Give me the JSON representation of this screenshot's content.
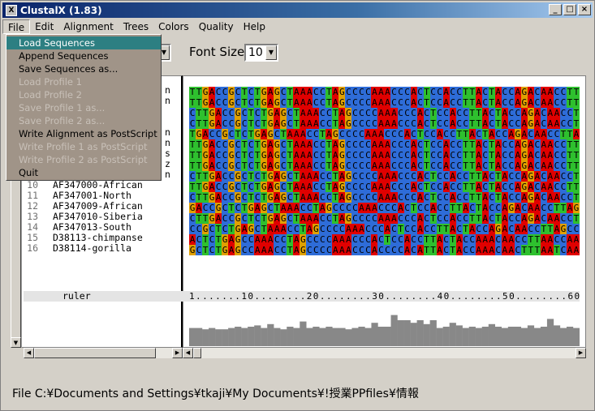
{
  "window": {
    "title": "ClustalX (1.83)",
    "app_icon": "X",
    "minimize": "_",
    "maximize": "□",
    "close": "×"
  },
  "menubar": [
    "File",
    "Edit",
    "Alignment",
    "Trees",
    "Colors",
    "Quality",
    "Help"
  ],
  "toolbar": {
    "font_size_label": "Font Size:",
    "font_size_value": "10"
  },
  "file_menu": [
    {
      "label": "Load Sequences",
      "state": "selected"
    },
    {
      "label": "Append Sequences",
      "state": "enabled"
    },
    {
      "label": "Save Sequences as...",
      "state": "enabled"
    },
    {
      "label": "Load Profile 1",
      "state": "disabled"
    },
    {
      "label": "Load Profile 2",
      "state": "disabled"
    },
    {
      "label": "Save Profile 1 as...",
      "state": "disabled"
    },
    {
      "label": "Save Profile 2 as...",
      "state": "disabled"
    },
    {
      "label": "Write Alignment as PostScript",
      "state": "enabled"
    },
    {
      "label": "Write Profile 1 as PostScript",
      "state": "disabled"
    },
    {
      "label": "Write Profile 2 as PostScript",
      "state": "disabled"
    },
    {
      "label": "Quit",
      "state": "enabled"
    }
  ],
  "sequences": [
    {
      "num": "",
      "name": "n",
      "seq": "TTGACCGCTCTGAGCTAAACCTAGCCCCAAACCCACTCCACCTTACTACCAGACAACCTT"
    },
    {
      "num": "",
      "name": "n",
      "seq": "TTGACCGCTCTGAGCTAAACCTAGCCCCAAACCCACTCCACCTTACTACCAGACAACCTT"
    },
    {
      "num": "",
      "name": "",
      "seq": "CTTGACCGCTCTGAGCTAAACCTAGCCCCAAACCCACTCCACCTTACTACCAGACAACCT"
    },
    {
      "num": "",
      "name": "",
      "seq": "CTTGACCGCTCTGAGCTAAACCTAGCCCCAAACCCACTCCACCTTACTACCAGACAACCT"
    },
    {
      "num": "",
      "name": "n",
      "seq": "TGACCGCTCTGAGCTAAACCTAGCCCCAAACCCACTCCACCTTACTACCAGACAACCTTA"
    },
    {
      "num": "",
      "name": "n",
      "seq": "TTGACCGCTCTGAGCTAAACCTAGCCCCAAACCCACTCCACCTTACTACCAGACAACCTT"
    },
    {
      "num": "",
      "name": "s",
      "seq": "TTGACCGCTCTGAGCTAAACCTAGCCCCAAACCCACTCCACCTTACTACCAGACAACCTT"
    },
    {
      "num": "",
      "name": "z",
      "seq": "TTGACCGCTCTGAGCTAAACCTAGCCCCAAACCCACTCCACCTTACTACCAGACAACCTT"
    },
    {
      "num": "",
      "name": "n",
      "seq": "CTTGACCGCTCTGAGCTAAACCTAGCCCCAAACCCACTCCACCTTACTACCAGACAACCT"
    },
    {
      "num": "10",
      "name": "AF347000-African",
      "seq": "TTGACCGCTCTGAGCTAAACCTAGCCCCAAACCCACTCCACCTTACTACCAGACAACCTT"
    },
    {
      "num": "11",
      "name": "AF347001-North",
      "seq": "CTTGACCGCTCTGAGCTAAACCTAGCCCCAAACCCACTCCACCTTACTACCAGACAACCT"
    },
    {
      "num": "12",
      "name": "AF347009-African",
      "seq": "GACCGCTCTGAGCTAAACCTAGCCCCAAACCCACTCCACCTTACTACCAGACAACCTTAG"
    },
    {
      "num": "13",
      "name": "AF347010-Siberia",
      "seq": "CTTGACCGCTCTGAGCTAAACCTAGCCCCAAACCCACTCCACCTTACTACCAGACAACCT"
    },
    {
      "num": "14",
      "name": "AF347013-South",
      "seq": "CCGCTCTGAGCTAAACCTAGCCCCAAACCCACTCCACCTTACTACCAGACAACCTTAGCC"
    },
    {
      "num": "15",
      "name": "D38113-chimpanse",
      "seq": "ACTCTGAGCCAAACCTAGCCCCAAACCCACTCCACCTTACTACCAAACAACCTTAACCAA"
    },
    {
      "num": "16",
      "name": "D38114-gorilla",
      "seq": "GCTCTGAGCCAAACCTAGCCCCAAACCCACCCCACATTACTACCAAACAACTTTAATCAA"
    }
  ],
  "ruler": {
    "label": "ruler",
    "text": "1.......10........20........30........40........50........60"
  },
  "quality_histogram": [
    14,
    14,
    13,
    14,
    13,
    13,
    14,
    15,
    14,
    15,
    16,
    14,
    17,
    14,
    13,
    15,
    14,
    19,
    14,
    15,
    14,
    15,
    14,
    14,
    13,
    14,
    15,
    14,
    18,
    15,
    15,
    24,
    20,
    20,
    18,
    20,
    17,
    20,
    14,
    15,
    18,
    16,
    14,
    15,
    14,
    15,
    17,
    15,
    14,
    15,
    15,
    14,
    16,
    14,
    15,
    21,
    16,
    14,
    15,
    14
  ],
  "status_bar": "File C:¥Documents and Settings¥tkaji¥My Documents¥!授業PPfiles¥情報",
  "colors": {
    "A": "#e00000",
    "C": "#2e6cd8",
    "G": "#e0a000",
    "T": "#2ec02e",
    "histogram_bar": "#888888"
  }
}
